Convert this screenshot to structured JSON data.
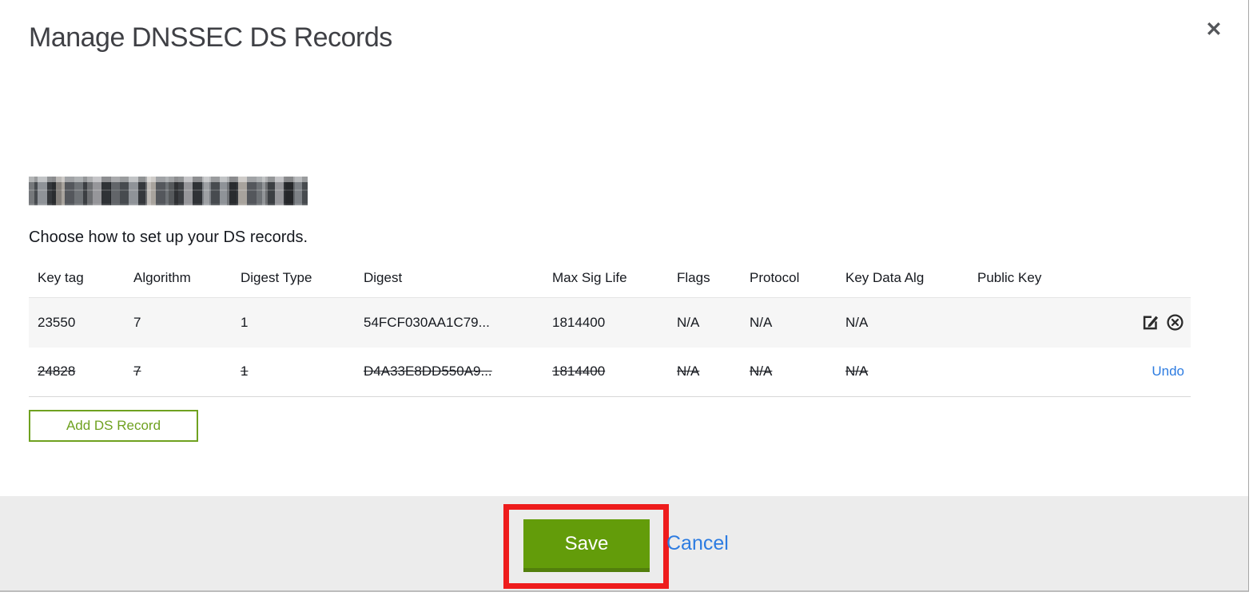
{
  "dialog": {
    "title": "Manage DNSSEC DS Records",
    "close_glyph": "✕",
    "instruction": "Choose how to set up your DS records."
  },
  "table": {
    "columns": [
      "Key tag",
      "Algorithm",
      "Digest Type",
      "Digest",
      "Max Sig Life",
      "Flags",
      "Protocol",
      "Key Data Alg",
      "Public Key"
    ],
    "rows": [
      {
        "key_tag": "23550",
        "algorithm": "7",
        "digest_type": "1",
        "digest": "54FCF030AA1C79...",
        "max_sig_life": "1814400",
        "flags": "N/A",
        "protocol": "N/A",
        "key_data_alg": "N/A",
        "public_key": "",
        "state": "active"
      },
      {
        "key_tag": "24828",
        "algorithm": "7",
        "digest_type": "1",
        "digest": "D4A33E8DD550A9...",
        "max_sig_life": "1814400",
        "flags": "N/A",
        "protocol": "N/A",
        "key_data_alg": "N/A",
        "public_key": "",
        "state": "deleted",
        "undo_label": "Undo"
      }
    ]
  },
  "buttons": {
    "add_ds_record": "Add DS Record",
    "save": "Save",
    "cancel": "Cancel"
  },
  "colors": {
    "save_green": "#639c0a",
    "outline_green": "#6fa120",
    "link_blue": "#2d7ce1",
    "annotation_red": "#ee1c1c",
    "footer_gray": "#ececec"
  }
}
